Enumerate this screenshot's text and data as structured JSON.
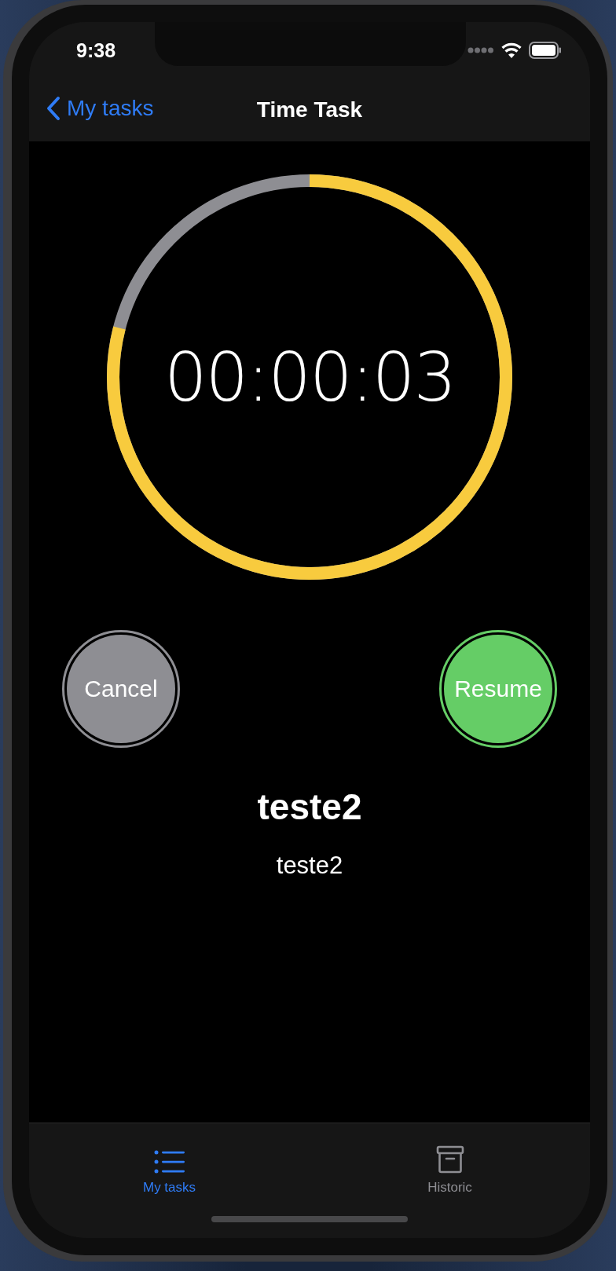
{
  "status_bar": {
    "time": "9:38"
  },
  "nav": {
    "back_label": "My tasks",
    "title": "Time Task"
  },
  "timer": {
    "time": "00:00:03",
    "level": 0.79
  },
  "buttons": [
    {
      "label": "Cancel",
      "kind": "cancel"
    },
    {
      "label": "Resume",
      "kind": "resume"
    }
  ],
  "task": {
    "title": "teste2",
    "description": "teste2"
  },
  "tabs": [
    {
      "label": "My tasks",
      "selected": true,
      "kind": "list"
    },
    {
      "label": "Historic",
      "selected": false,
      "kind": "archive"
    }
  ]
}
